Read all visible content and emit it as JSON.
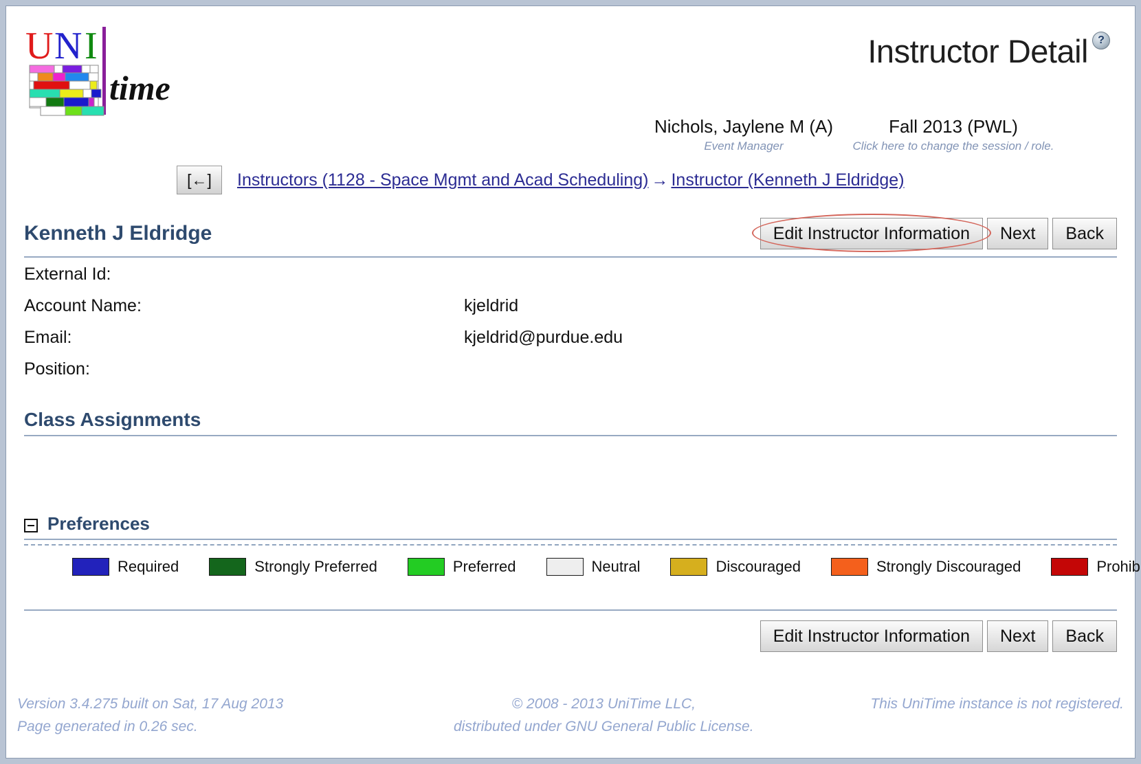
{
  "app": {
    "logo_alt": "UniTime",
    "logo_text_uni": "UNI",
    "logo_text_time": "time"
  },
  "header": {
    "title": "Instructor Detail",
    "help_icon_label": "?",
    "user_name": "Nichols, Jaylene M (A)",
    "user_role": "Event Manager",
    "session": "Fall 2013 (PWL)",
    "session_change_hint": "Click here to change the session / role."
  },
  "breadcrumb": {
    "back_button_label": "[←]",
    "items": [
      "Instructors (1128 - Space Mgmt and Acad Scheduling)",
      "Instructor (Kenneth J Eldridge)"
    ],
    "separator": "→"
  },
  "instructor": {
    "name": "Kenneth J Eldridge",
    "fields": [
      {
        "label": "External Id:",
        "value": ""
      },
      {
        "label": "Account Name:",
        "value": "kjeldrid"
      },
      {
        "label": "Email:",
        "value": "kjeldrid@purdue.edu"
      },
      {
        "label": "Position:",
        "value": ""
      }
    ]
  },
  "toolbar": {
    "edit_label": "Edit Instructor Information",
    "next_label": "Next",
    "back_label": "Back"
  },
  "sections": {
    "class_assignments": "Class Assignments",
    "preferences": "Preferences"
  },
  "legend": {
    "items": [
      {
        "label": "Required",
        "color": "#2222bb"
      },
      {
        "label": "Strongly Preferred",
        "color": "#14661c"
      },
      {
        "label": "Preferred",
        "color": "#23cc23"
      },
      {
        "label": "Neutral",
        "color": "#eeeeee"
      },
      {
        "label": "Discouraged",
        "color": "#d6af1e"
      },
      {
        "label": "Strongly Discouraged",
        "color": "#f4601c"
      },
      {
        "label": "Prohibited",
        "color": "#c40606"
      }
    ]
  },
  "footer": {
    "version": "Version 3.4.275 built on Sat, 17 Aug 2013",
    "generated": "Page generated in 0.26 sec.",
    "copyright": "© 2008 - 2013 UniTime LLC,",
    "license": "distributed under GNU General Public License.",
    "registration": "This UniTime instance is not registered."
  }
}
